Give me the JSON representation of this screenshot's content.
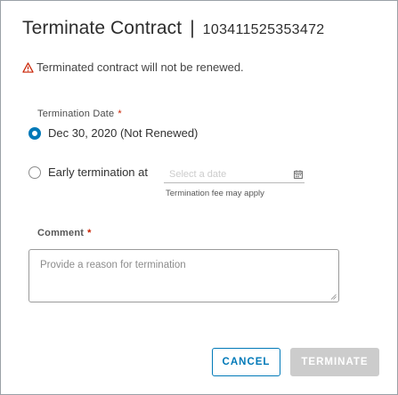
{
  "dialog": {
    "title": "Terminate Contract",
    "separator": "|",
    "contract_id": "103411525353472",
    "warning": "Terminated contract will not be renewed."
  },
  "termination_date": {
    "label": "Termination Date",
    "required_mark": "*",
    "option_end": "Dec 30, 2020 (Not Renewed)",
    "option_early": "Early termination at",
    "date_placeholder": "Select a date",
    "hint": "Termination fee may apply",
    "selected": "end"
  },
  "comment": {
    "label": "Comment",
    "required_mark": "*",
    "placeholder": "Provide a reason for termination"
  },
  "actions": {
    "cancel_label": "CANCEL",
    "terminate_label": "TERMINATE"
  },
  "colors": {
    "accent": "#0079b8",
    "warning": "#c92100",
    "disabled": "#cccccc"
  },
  "icons": [
    "warning-icon",
    "calendar-icon"
  ]
}
